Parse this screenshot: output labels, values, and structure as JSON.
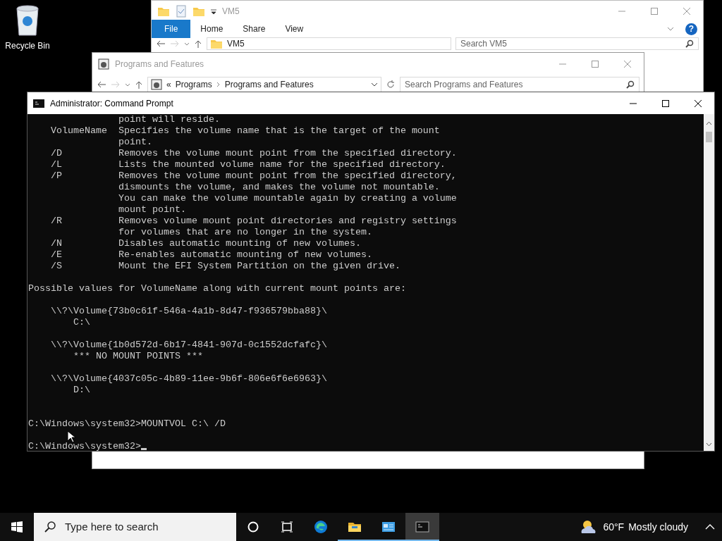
{
  "desktop": {
    "icons": [
      {
        "label": "Recycle Bin"
      }
    ]
  },
  "explorer_window": {
    "title": "VM5",
    "ribbon_tabs": [
      {
        "label": "File",
        "selected": true
      },
      {
        "label": "Home",
        "selected": false
      },
      {
        "label": "Share",
        "selected": false
      },
      {
        "label": "View",
        "selected": false
      }
    ],
    "help": "?",
    "address": {
      "path": [
        "VM5"
      ]
    },
    "search": {
      "placeholder": "Search VM5"
    }
  },
  "programs_window": {
    "title": "Programs and Features",
    "address": {
      "overflow": "«",
      "path": [
        "Programs",
        "Programs and Features"
      ]
    },
    "search": {
      "placeholder": "Search Programs and Features"
    }
  },
  "command_prompt": {
    "title": "Administrator: Command Prompt",
    "cursor": true,
    "blocks": [
      {
        "extra_space_after": false,
        "lines": [
          "                point will reside.",
          "    VolumeName  Specifies the volume name that is the target of the mount",
          "                point.",
          "    /D          Removes the volume mount point from the specified directory.",
          "    /L          Lists the mounted volume name for the specified directory.",
          "    /P          Removes the volume mount point from the specified directory,",
          "                dismounts the volume, and makes the volume not mountable.",
          "                You can make the volume mountable again by creating a volume",
          "                mount point.",
          "    /R          Removes volume mount point directories and registry settings",
          "                for volumes that are no longer in the system.",
          "    /N          Disables automatic mounting of new volumes.",
          "    /E          Re-enables automatic mounting of new volumes.",
          "    /S          Mount the EFI System Partition on the given drive."
        ]
      },
      {
        "extra_space_after": false,
        "lines": [
          "Possible values for VolumeName along with current mount points are:"
        ]
      },
      {
        "extra_space_after": false,
        "lines": [
          "    \\\\?\\Volume{73b0c61f-546a-4a1b-8d47-f936579bba88}\\",
          "        C:\\"
        ]
      },
      {
        "extra_space_after": false,
        "lines": [
          "    \\\\?\\Volume{1b0d572d-6b17-4841-907d-0c1552dcfafc}\\",
          "        *** NO MOUNT POINTS ***"
        ]
      },
      {
        "extra_space_after": true,
        "lines": [
          "    \\\\?\\Volume{4037c05c-4b89-11ee-9b6f-806e6f6e6963}\\",
          "        D:\\"
        ]
      },
      {
        "extra_space_after": false,
        "lines": [
          "C:\\Windows\\system32>MOUNTVOL C:\\ /D"
        ]
      },
      {
        "extra_space_after": false,
        "lines": [
          "C:\\Windows\\system32>"
        ]
      }
    ]
  },
  "taskbar": {
    "search": {
      "placeholder": "Type here to search"
    },
    "apps": [
      {
        "kind": "cortana",
        "open": false,
        "selected": false
      },
      {
        "kind": "task-view",
        "open": false,
        "selected": false
      },
      {
        "kind": "edge",
        "open": false,
        "selected": false
      },
      {
        "kind": "file-explorer",
        "open": true,
        "selected": false
      },
      {
        "kind": "control-panel",
        "open": true,
        "selected": false
      },
      {
        "kind": "command-prompt",
        "open": true,
        "selected": true
      }
    ],
    "weather": {
      "temperature": "60°F",
      "condition": "Mostly cloudy"
    }
  }
}
